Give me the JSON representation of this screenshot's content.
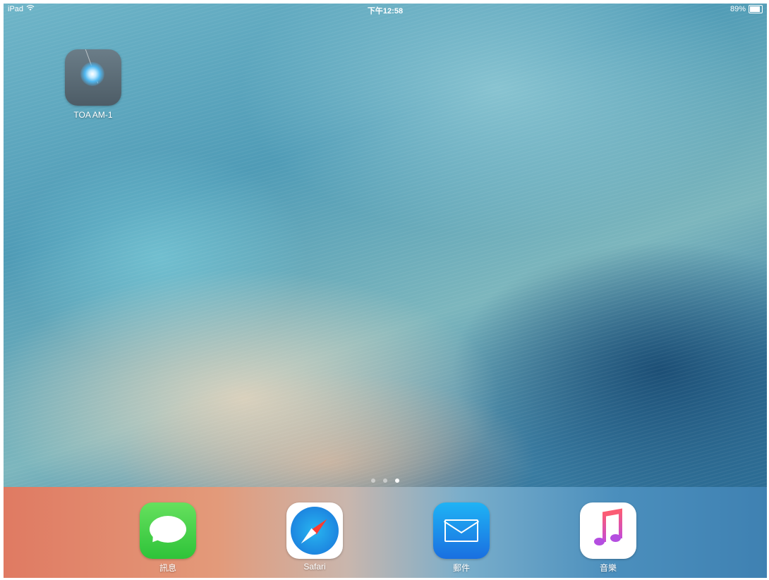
{
  "status_bar": {
    "device": "iPad",
    "time": "下午12:58",
    "battery": "89%",
    "battery_level": 0.89
  },
  "home": {
    "apps": [
      {
        "label": "TOA AM-1",
        "icon": "toa-am1-app-icon"
      }
    ],
    "page_dots": {
      "count": 3,
      "active_index": 2
    }
  },
  "dock": {
    "apps": [
      {
        "label": "訊息",
        "icon": "messages-icon"
      },
      {
        "label": "Safari",
        "icon": "safari-icon"
      },
      {
        "label": "郵件",
        "icon": "mail-icon"
      },
      {
        "label": "音樂",
        "icon": "music-icon"
      }
    ]
  }
}
